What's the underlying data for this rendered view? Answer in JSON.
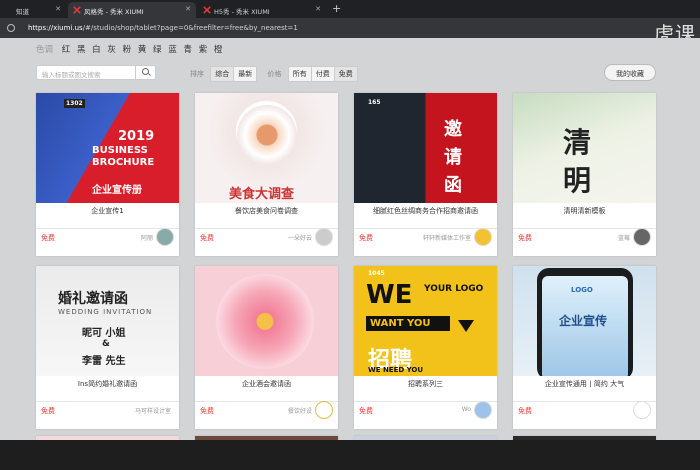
{
  "browser": {
    "tabs": [
      {
        "label": "知道"
      },
      {
        "label": "风格秀 - 秀米 XIUMI"
      },
      {
        "label": "H5秀 - 秀米 XIUMI"
      }
    ],
    "url_host": "https://xiumi.us",
    "url_path": "/#/studio/shop/tablet?page=0&freefilter=free&by_nearest=1"
  },
  "watermark": "虎课",
  "filters": {
    "color_label": "色调",
    "colors": [
      "红",
      "黑",
      "白",
      "灰",
      "粉",
      "黄",
      "绿",
      "蓝",
      "青",
      "紫",
      "橙"
    ],
    "search_placeholder": "输入标题或图文搜索",
    "sort_label": "排序",
    "sort_options": [
      "综合",
      "最新"
    ],
    "price_label": "价格",
    "price_options": [
      "所有",
      "付费",
      "免费"
    ],
    "favorites_button": "我的收藏"
  },
  "cards": [
    {
      "title": "企业宣传1",
      "price": "免费",
      "author": "阿丽",
      "thumb_lines": [
        "2019",
        "BUSINESS",
        "BROCHURE",
        "企业宣传册"
      ],
      "badge": "1302"
    },
    {
      "title": "餐饮店美食问卷调查",
      "price": "免费",
      "author": "一朵好云",
      "thumb_lines": [
        "美食大调查"
      ],
      "badge": ""
    },
    {
      "title": "细腻红色丝绸商务合作招商邀请函",
      "price": "免费",
      "author": "轩轩新媒体工作室",
      "thumb_lines": [
        "邀",
        "请",
        "函"
      ],
      "badge": "165"
    },
    {
      "title": "清明清新模板",
      "price": "免费",
      "author": "蓝莓",
      "thumb_lines": [
        "清",
        "明"
      ],
      "badge": ""
    },
    {
      "title": "Ins简约婚礼邀请函",
      "price": "免费",
      "author": "马可样设计室",
      "thumb_lines": [
        "婚礼邀请函",
        "WEDDING INVITATION",
        "昵可 小姐",
        "&",
        "李雷 先生"
      ],
      "badge": ""
    },
    {
      "title": "企业酒会邀请函",
      "price": "免费",
      "author": "餐饮好设",
      "thumb_lines": [],
      "badge": ""
    },
    {
      "title": "招聘系列三",
      "price": "免费",
      "author": "Wo",
      "thumb_lines": [
        "WE",
        "YOUR LOGO",
        "WANT YOU",
        "招聘",
        "WE NEED YOU"
      ],
      "badge": "1045"
    },
    {
      "title": "企业宣传通用丨简约 大气",
      "price": "免费",
      "author": "",
      "thumb_lines": [
        "企业宣传",
        "LOGO"
      ],
      "badge": ""
    }
  ]
}
